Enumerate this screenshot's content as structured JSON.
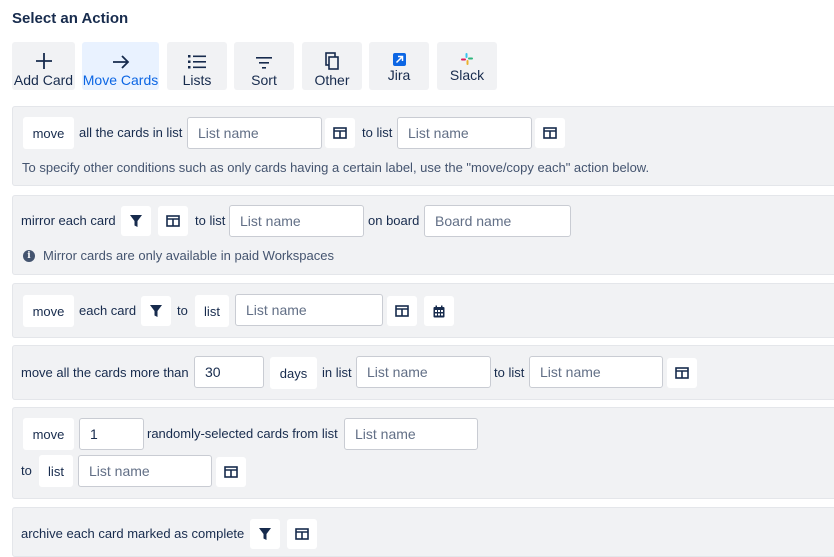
{
  "title": "Select an Action",
  "tabs": [
    {
      "label": "Add Card",
      "icon": "plus-icon"
    },
    {
      "label": "Move Cards",
      "icon": "arrow-right-icon",
      "active": true
    },
    {
      "label": "Lists",
      "icon": "list-icon"
    },
    {
      "label": "Sort",
      "icon": "sort-icon"
    },
    {
      "label": "Other",
      "icon": "copy-icon"
    },
    {
      "label": "Jira",
      "icon": "jira-icon"
    },
    {
      "label": "Slack",
      "icon": "slack-icon"
    }
  ],
  "colors": {
    "active_bg": "#e9f2ff",
    "active_text": "#0c66e4",
    "panel_bg": "#f1f2f4",
    "text": "#172b4d"
  },
  "action1": {
    "move": "move",
    "text1": "all the cards in list",
    "list_placeholder": "List name",
    "to_list": "to list",
    "target_placeholder": "List name",
    "help": "To specify other conditions such as only cards having a certain label, use the \"move/copy each\" action below."
  },
  "action2": {
    "text1": "mirror each card",
    "to_list": "to list",
    "list_placeholder": "List name",
    "on_board": "on board",
    "board_placeholder": "Board name",
    "note": "Mirror cards are only available in paid Workspaces"
  },
  "action3": {
    "move": "move",
    "each_card": "each card",
    "to": "to",
    "list": "list",
    "list_placeholder": "List name"
  },
  "action4": {
    "text1": "move all the cards more than",
    "days_value": "30",
    "days": "days",
    "in_list": "in list",
    "list_placeholder": "List name",
    "to_list": "to list",
    "target_placeholder": "List name"
  },
  "action5": {
    "move": "move",
    "count_value": "1",
    "text1": "randomly-selected cards from list",
    "list_placeholder": "List name",
    "to": "to",
    "list": "list",
    "target_placeholder": "List name"
  },
  "action6": {
    "text1": "archive each card marked as complete"
  }
}
